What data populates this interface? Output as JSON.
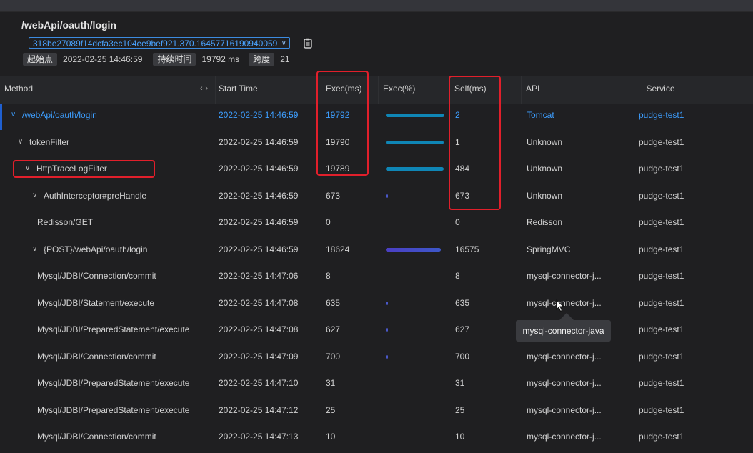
{
  "header": {
    "title": "/webApi/oauth/login",
    "trace_id": "318be27089f14dcfa3ec104ee9bef921.370.16457716190940059",
    "start_label": "起始点",
    "start_value": "2022-02-25 14:46:59",
    "duration_label": "持续时间",
    "duration_value": "19792 ms",
    "span_label": "跨度",
    "span_value": "21"
  },
  "columns": {
    "method": "Method",
    "resize": "‹·›",
    "start_time": "Start Time",
    "exec_ms": "Exec(ms)",
    "exec_pct": "Exec(%)",
    "self_ms": "Self(ms)",
    "api": "API",
    "service": "Service"
  },
  "rows": [
    {
      "method": "/webApi/oauth/login",
      "start": "2022-02-25 14:46:59",
      "exec": "19792",
      "pct": 1.0,
      "self": "2",
      "api": "Tomcat",
      "service": "pudge-test1"
    },
    {
      "method": "tokenFilter",
      "start": "2022-02-25 14:46:59",
      "exec": "19790",
      "pct": 0.99,
      "self": "1",
      "api": "Unknown",
      "service": "pudge-test1"
    },
    {
      "method": "HttpTraceLogFilter",
      "start": "2022-02-25 14:46:59",
      "exec": "19789",
      "pct": 0.99,
      "self": "484",
      "api": "Unknown",
      "service": "pudge-test1"
    },
    {
      "method": "AuthInterceptor#preHandle",
      "start": "2022-02-25 14:46:59",
      "exec": "673",
      "pct": 0.034,
      "self": "673",
      "api": "Unknown",
      "service": "pudge-test1"
    },
    {
      "method": "Redisson/GET",
      "start": "2022-02-25 14:46:59",
      "exec": "0",
      "pct": 0,
      "self": "0",
      "api": "Redisson",
      "service": "pudge-test1"
    },
    {
      "method": "{POST}/webApi/oauth/login",
      "start": "2022-02-25 14:46:59",
      "exec": "18624",
      "pct": 0.94,
      "self": "16575",
      "api": "SpringMVC",
      "service": "pudge-test1"
    },
    {
      "method": "Mysql/JDBI/Connection/commit",
      "start": "2022-02-25 14:47:06",
      "exec": "8",
      "pct": 0,
      "self": "8",
      "api": "mysql-connector-j...",
      "service": "pudge-test1"
    },
    {
      "method": "Mysql/JDBI/Statement/execute",
      "start": "2022-02-25 14:47:08",
      "exec": "635",
      "pct": 0.032,
      "self": "635",
      "api": "mysql-connector-j...",
      "service": "pudge-test1"
    },
    {
      "method": "Mysql/JDBI/PreparedStatement/execute",
      "start": "2022-02-25 14:47:08",
      "exec": "627",
      "pct": 0.032,
      "self": "627",
      "api": "mysql-connector-j...",
      "service": "pudge-test1"
    },
    {
      "method": "Mysql/JDBI/Connection/commit",
      "start": "2022-02-25 14:47:09",
      "exec": "700",
      "pct": 0.035,
      "self": "700",
      "api": "mysql-connector-j...",
      "service": "pudge-test1"
    },
    {
      "method": "Mysql/JDBI/PreparedStatement/execute",
      "start": "2022-02-25 14:47:10",
      "exec": "31",
      "pct": 0,
      "self": "31",
      "api": "mysql-connector-j...",
      "service": "pudge-test1"
    },
    {
      "method": "Mysql/JDBI/PreparedStatement/execute",
      "start": "2022-02-25 14:47:12",
      "exec": "25",
      "pct": 0,
      "self": "25",
      "api": "mysql-connector-j...",
      "service": "pudge-test1"
    },
    {
      "method": "Mysql/JDBI/Connection/commit",
      "start": "2022-02-25 14:47:13",
      "exec": "10",
      "pct": 0,
      "self": "10",
      "api": "mysql-connector-j...",
      "service": "pudge-test1"
    }
  ],
  "tooltip": "mysql-connector-java",
  "colors": {
    "accent": "#3d9eff",
    "highlight": "#e11f2b",
    "bar_teal": "#0f86b6",
    "bar_purple": "#5548c8"
  }
}
